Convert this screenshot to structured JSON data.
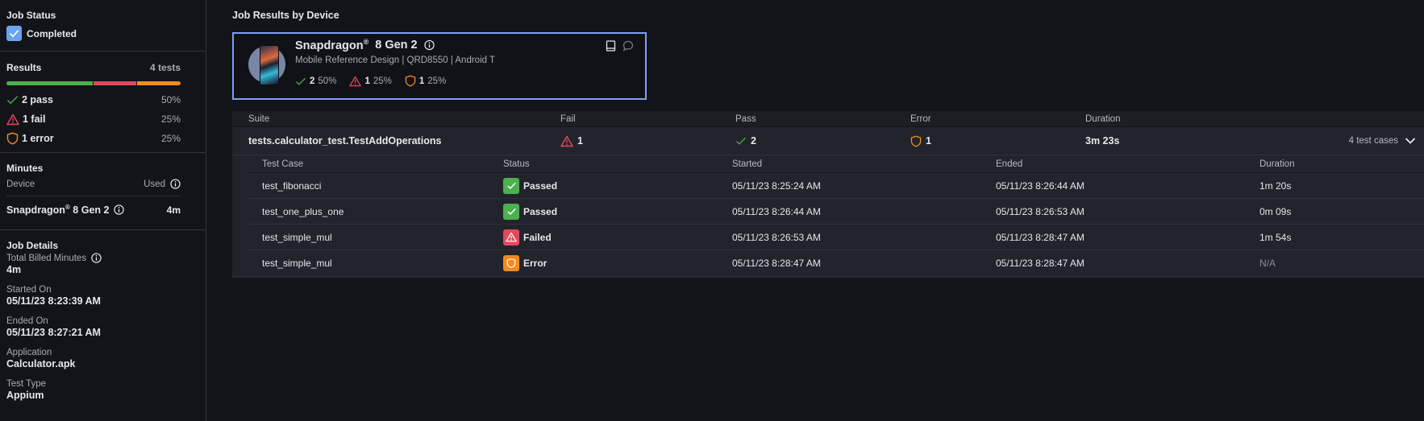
{
  "sidebar": {
    "job_status": {
      "title": "Job Status",
      "value": "Completed"
    },
    "results": {
      "title": "Results",
      "count_label": "4 tests",
      "breakdown": {
        "pass_fraction": 0.5,
        "fail_fraction": 0.25,
        "error_fraction": 0.25
      },
      "items": [
        {
          "label": "2 pass",
          "percent": "50%",
          "icon": "check-icon"
        },
        {
          "label": "1 fail",
          "percent": "25%",
          "icon": "warning-triangle-icon"
        },
        {
          "label": "1 error",
          "percent": "25%",
          "icon": "shield-icon"
        }
      ]
    },
    "minutes": {
      "title": "Minutes",
      "col_device": "Device",
      "col_used": "Used",
      "device_name": "Snapdragon",
      "device_reg": "®",
      "device_model": " 8 Gen 2",
      "used": "4m"
    },
    "job_details": {
      "title": "Job Details",
      "fields": [
        {
          "label": "Total Billed Minutes",
          "value": "4m"
        },
        {
          "label": "Started On",
          "value": "05/11/23 8:23:39 AM"
        },
        {
          "label": "Ended On",
          "value": "05/11/23 8:27:21 AM"
        },
        {
          "label": "Application",
          "value": "Calculator.apk"
        },
        {
          "label": "Test Type",
          "value": "Appium"
        }
      ]
    }
  },
  "main": {
    "title": "Job Results by Device",
    "device_card": {
      "name": "Snapdragon",
      "reg": "®",
      "model": "8 Gen 2",
      "subtitle": "Mobile Reference Design | QRD8550 | Android T",
      "stats": [
        {
          "count": "2",
          "percent": "50%",
          "icon": "check-icon"
        },
        {
          "count": "1",
          "percent": "25%",
          "icon": "warning-triangle-icon"
        },
        {
          "count": "1",
          "percent": "25%",
          "icon": "shield-icon"
        }
      ]
    },
    "suite_table": {
      "headers": {
        "suite": "Suite",
        "fail": "Fail",
        "pass": "Pass",
        "error": "Error",
        "duration": "Duration"
      },
      "suite": {
        "name": "tests.calculator_test.TestAddOperations",
        "fail": "1",
        "pass": "2",
        "error": "1",
        "duration": "3m 23s",
        "case_count": "4 test cases"
      },
      "case_headers": {
        "name": "Test Case",
        "status": "Status",
        "started": "Started",
        "ended": "Ended",
        "duration": "Duration"
      },
      "cases": [
        {
          "name": "test_fibonacci",
          "status": "Passed",
          "started": "05/11/23 8:25:24 AM",
          "ended": "05/11/23 8:26:44 AM",
          "duration": "1m 20s"
        },
        {
          "name": "test_one_plus_one",
          "status": "Passed",
          "started": "05/11/23 8:26:44 AM",
          "ended": "05/11/23 8:26:53 AM",
          "duration": "0m 09s"
        },
        {
          "name": "test_simple_mul",
          "status": "Failed",
          "started": "05/11/23 8:26:53 AM",
          "ended": "05/11/23 8:28:47 AM",
          "duration": "1m 54s"
        },
        {
          "name": "test_simple_mul",
          "status": "Error",
          "started": "05/11/23 8:28:47 AM",
          "ended": "05/11/23 8:28:47 AM",
          "duration": "N/A"
        }
      ]
    }
  },
  "colors": {
    "pass": "#4caf50",
    "fail": "#e5485d",
    "error": "#f28a1e",
    "accent": "#7aa2f7",
    "completed": "#6aa4f0"
  }
}
